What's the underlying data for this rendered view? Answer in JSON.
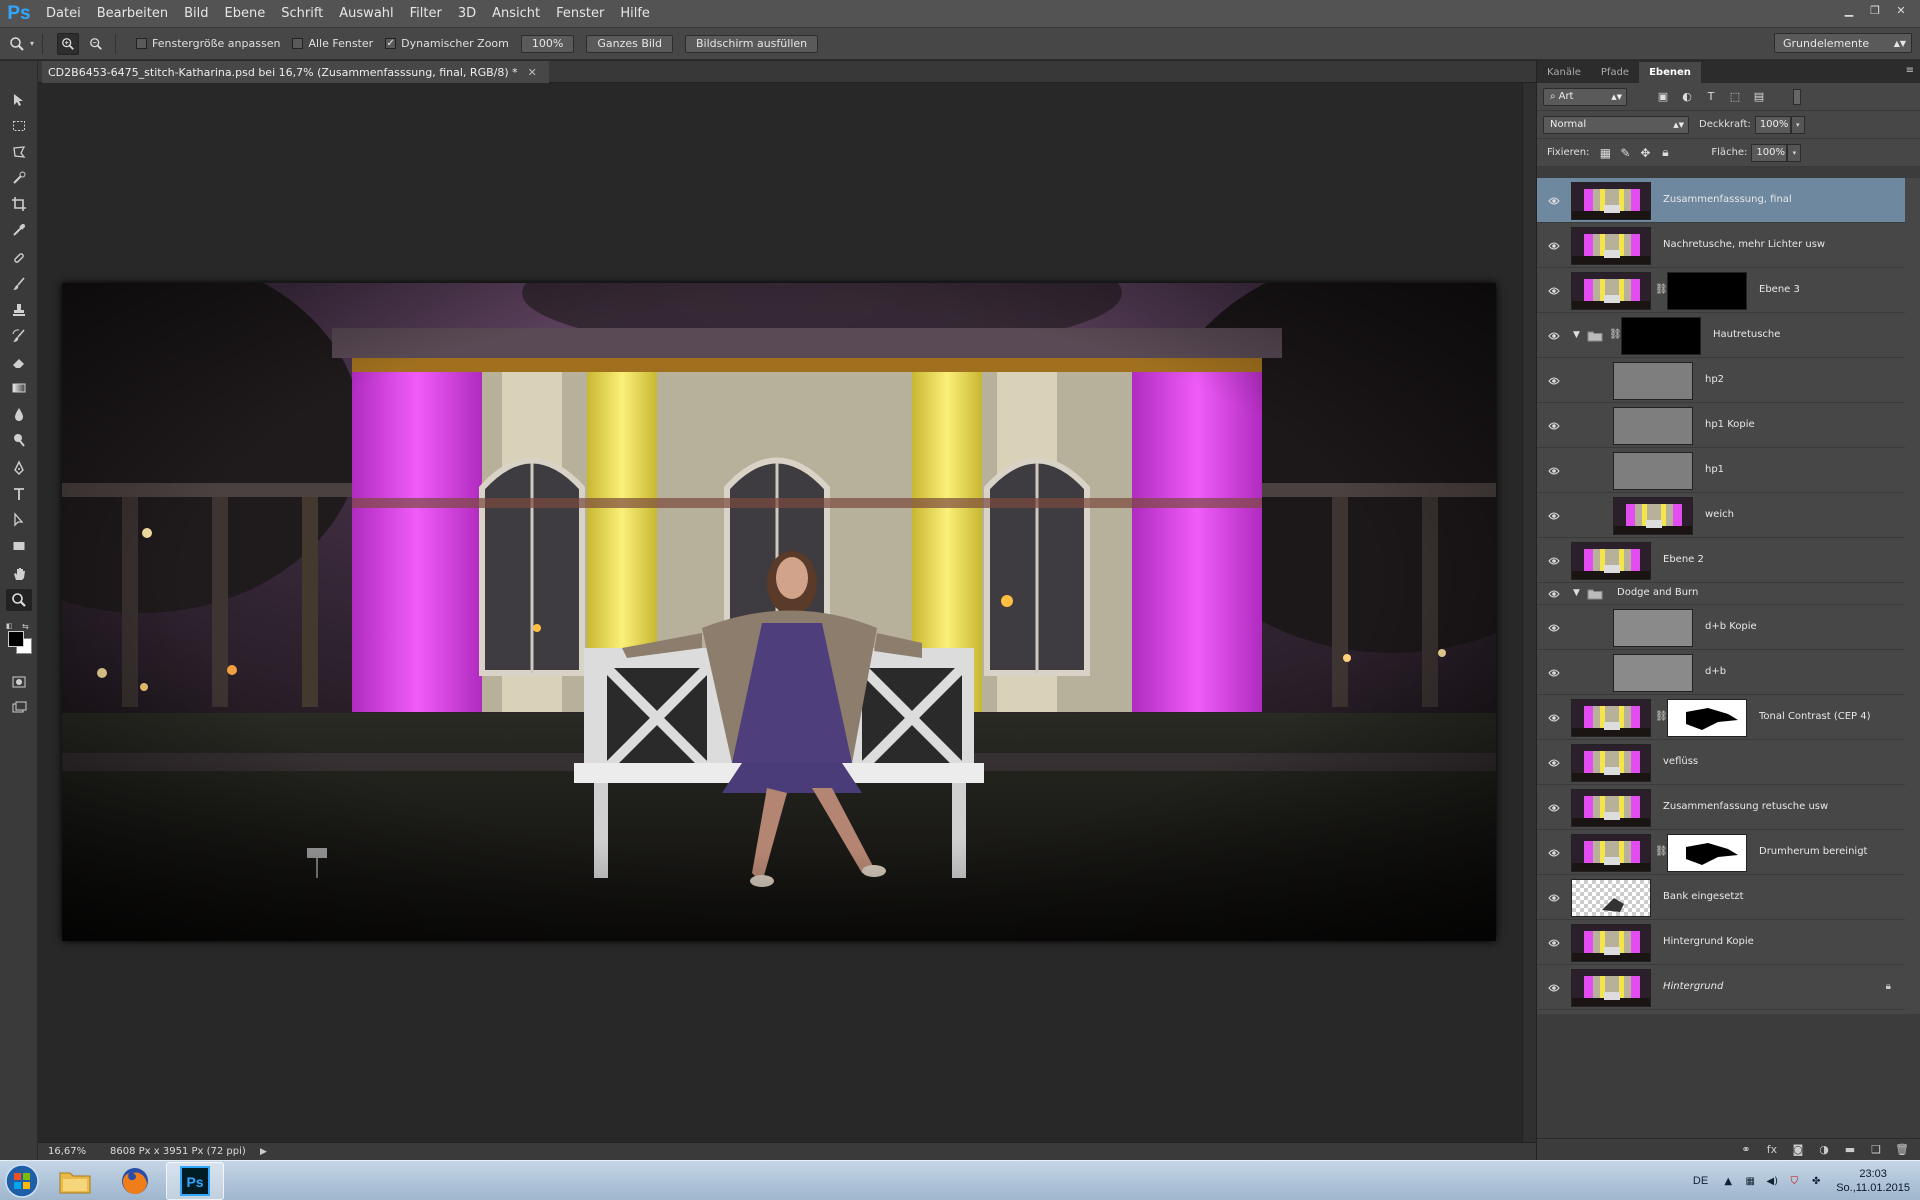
{
  "app": {
    "logo": "Ps",
    "menu": [
      "Datei",
      "Bearbeiten",
      "Bild",
      "Ebene",
      "Schrift",
      "Auswahl",
      "Filter",
      "3D",
      "Ansicht",
      "Fenster",
      "Hilfe"
    ],
    "window_controls": [
      "minimize-icon",
      "restore-icon",
      "close-icon"
    ]
  },
  "options": {
    "fit_window_label": "Fenstergröße anpassen",
    "fit_window_checked": false,
    "all_windows_label": "Alle Fenster",
    "all_windows_checked": false,
    "dynamic_zoom_label": "Dynamischer Zoom",
    "dynamic_zoom_checked": true,
    "btn_100": "100%",
    "btn_fit": "Ganzes Bild",
    "btn_fill": "Bildschirm ausfüllen",
    "workspace": "Grundelemente"
  },
  "document": {
    "tab_title": "CD2B6453-6475_stitch-Katharina.psd bei 16,7% (Zusammenfasssung, final, RGB/8) *",
    "zoom": "16,67%",
    "size_info": "8608 Px x 3951 Px (72 ppi)"
  },
  "layers_panel": {
    "tabs": [
      "Kanäle",
      "Pfade",
      "Ebenen"
    ],
    "active_tab": "Ebenen",
    "filter_kind": "Art",
    "blend_mode": "Normal",
    "opacity_label": "Deckkraft:",
    "opacity_value": "100%",
    "lock_label": "Fixieren:",
    "fill_label": "Fläche:",
    "fill_value": "100%",
    "layers": [
      {
        "name": "Zusammenfasssung, final",
        "thumb": "photo",
        "selected": true
      },
      {
        "name": "Nachretusche, mehr Lichter usw",
        "thumb": "photo"
      },
      {
        "name": "Ebene 3",
        "thumb": "photo",
        "mask": "black"
      },
      {
        "name": "Hautretusche",
        "thumb": "folder",
        "mask": "black",
        "group": true
      },
      {
        "name": "hp2",
        "thumb": "gray",
        "indent": true
      },
      {
        "name": "hp1 Kopie",
        "thumb": "gray",
        "indent": true
      },
      {
        "name": "hp1",
        "thumb": "gray",
        "indent": true
      },
      {
        "name": "weich",
        "thumb": "photo",
        "indent": true
      },
      {
        "name": "Ebene 2",
        "thumb": "photo"
      },
      {
        "name": "Dodge and Burn",
        "thumb": "folder",
        "group": true,
        "small": true
      },
      {
        "name": "d+b Kopie",
        "thumb": "gray",
        "indent": true
      },
      {
        "name": "d+b",
        "thumb": "gray",
        "indent": true
      },
      {
        "name": "Tonal Contrast (CEP 4)",
        "thumb": "photo",
        "mask": "white"
      },
      {
        "name": "veflüss",
        "thumb": "photo"
      },
      {
        "name": "Zusammenfassung retusche usw",
        "thumb": "photo"
      },
      {
        "name": "Drumherum bereinigt",
        "thumb": "photo",
        "mask": "white"
      },
      {
        "name": "Bank eingesetzt",
        "thumb": "checker"
      },
      {
        "name": "Hintergrund Kopie",
        "thumb": "photo"
      },
      {
        "name": "Hintergrund",
        "thumb": "photo",
        "italic": true,
        "locked": true
      }
    ]
  },
  "taskbar": {
    "language": "DE",
    "time": "23:03",
    "date": "So.,11.01.2015"
  },
  "colors": {
    "selected_layer": "#6d889f",
    "accent_ps": "#31a8ff",
    "magenta_light": "#e23cf0",
    "yellow_light": "#f3e54a"
  }
}
